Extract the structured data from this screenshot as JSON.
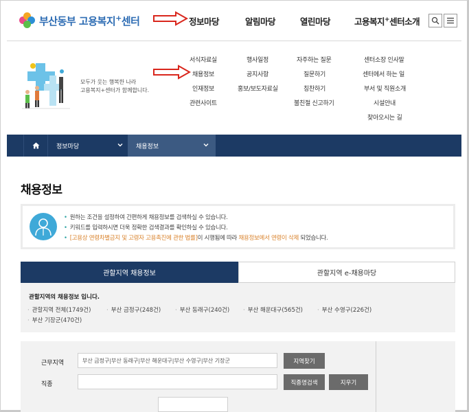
{
  "header": {
    "logo_text": "부산동부 고용복지",
    "logo_plus": "+",
    "logo_suffix": "센터",
    "nav": [
      {
        "label": "정보마당"
      },
      {
        "label": "알림마당"
      },
      {
        "label": "열린마당"
      },
      {
        "label_pre": "고용복지",
        "label_sup": "+",
        "label_post": "센터소개"
      }
    ],
    "search_icon": "search-icon",
    "menu_icon": "hamburger-menu-icon"
  },
  "promo": {
    "line1": "모두가 웃는 행복한 나라",
    "line2": "고용복지+센터가 함께합니다."
  },
  "submenu": {
    "col1": [
      "서식자료실",
      "채용정보",
      "인재정보",
      "관련사이트"
    ],
    "col2": [
      "행사일정",
      "공지사항",
      "홍보/보도자료실"
    ],
    "col3": [
      "자주하는 질문",
      "질문하기",
      "칭찬하기",
      "불친절 신고하기"
    ],
    "col4": [
      "센터소장 인사말",
      "센터에서 하는 일",
      "부서 및 직원소개",
      "시설안내",
      "찾아오시는 길"
    ]
  },
  "breadcrumb": {
    "home_icon": "home-icon",
    "level1": "정보마당",
    "level2": "채용정보"
  },
  "page": {
    "title": "채용정보"
  },
  "notice": {
    "icon": "person-icon",
    "line1": "원하는 조건을 설정하여 간편하게 채용정보를 검색하실 수 있습니다.",
    "line2": "키워드를 입력하시면 더욱 정확한 검색결과를 확인하실 수 있습니다.",
    "line3_a": "[고용상 연령차별금지 및 고령자 고용촉진에 관한 법률]",
    "line3_b": "이 시행됨에 따라 ",
    "line3_c": "채용정보에서 연령이 삭제",
    "line3_d": " 되었습니다."
  },
  "tabs": {
    "active": "관할지역 채용정보",
    "inactive": "관할지역 e-채용마당"
  },
  "regions": {
    "title": "관할지역의 채용정보 입니다.",
    "items": [
      "관할지역 전체(1749건)",
      "부산 금정구(248건)",
      "부산 동래구(240건)",
      "부산 해운대구(565건)",
      "부산 수영구(226건)",
      "부산 기장군(470건)"
    ]
  },
  "form": {
    "area_label": "근무지역",
    "area_value": "부산 금정구|부산 동래구|부산 해운대구|부산 수영구|부산 기장군",
    "area_button": "지역찾기",
    "job_label": "직종",
    "job_value": "",
    "job_button": "직종명검색",
    "clear_button": "지우기"
  },
  "colors": {
    "brand_blue": "#2d6cb3",
    "navy": "#1c3a64",
    "annotation_red": "#d9261c",
    "accent_orange": "#d9822b",
    "accent_teal": "#33a6a6"
  }
}
